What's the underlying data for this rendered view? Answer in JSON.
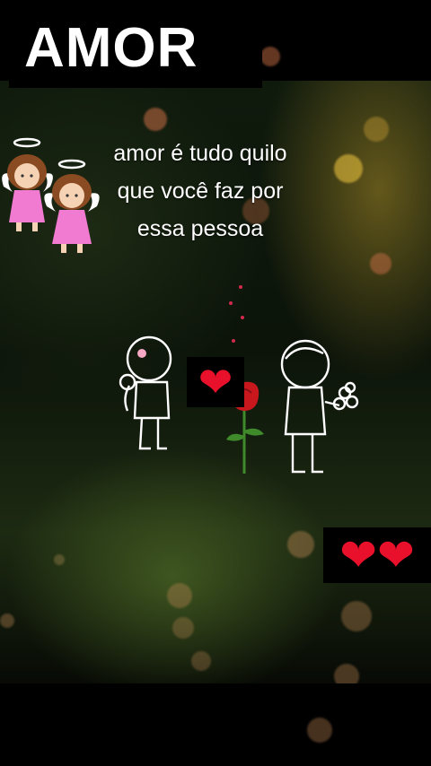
{
  "title": "AMOR",
  "caption": "amor é tudo quilo que você faz por essa pessoa",
  "colors": {
    "heart": "#e8102a",
    "rose": "#c8181e",
    "text": "#ffffff",
    "background": "#000000"
  },
  "icons": {
    "angels": [
      "angel-girl-icon",
      "angel-girl-icon"
    ],
    "hearts_single": [
      "red-heart-icon"
    ],
    "hearts_double": [
      "red-heart-icon",
      "red-heart-icon"
    ]
  }
}
